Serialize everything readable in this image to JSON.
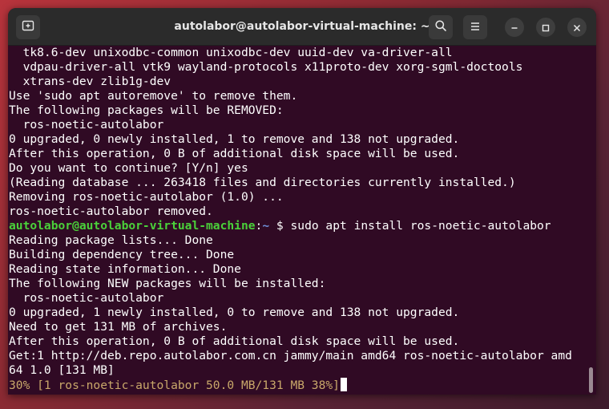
{
  "window": {
    "title": "autolabor@autolabor-virtual-machine: ~"
  },
  "icons": {
    "new_tab": "new-tab-icon",
    "search": "search-icon",
    "menu": "hamburger-menu-icon",
    "minimize": "minimize-icon",
    "maximize": "maximize-icon",
    "close": "close-icon"
  },
  "colors": {
    "terminal_bg": "#300a24",
    "prompt_user": "#4ad13a",
    "prompt_path": "#6f8fd8",
    "progress_text": "#c9a86a"
  },
  "terminal": {
    "lines_before": [
      "  tk8.6-dev unixodbc-common unixodbc-dev uuid-dev va-driver-all",
      "  vdpau-driver-all vtk9 wayland-protocols x11proto-dev xorg-sgml-doctools",
      "  xtrans-dev zlib1g-dev",
      "Use 'sudo apt autoremove' to remove them.",
      "The following packages will be REMOVED:",
      "  ros-noetic-autolabor",
      "0 upgraded, 0 newly installed, 1 to remove and 138 not upgraded.",
      "After this operation, 0 B of additional disk space will be used.",
      "Do you want to continue? [Y/n] yes",
      "(Reading database ... 263418 files and directories currently installed.)",
      "Removing ros-noetic-autolabor (1.0) ...",
      "ros-noetic-autolabor removed."
    ],
    "prompt": {
      "user_host": "autolabor@autolabor-virtual-machine",
      "separator": ":",
      "path": "~",
      "command": "$ sudo apt install ros-noetic-autolabor"
    },
    "lines_after": [
      "Reading package lists... Done",
      "Building dependency tree... Done",
      "Reading state information... Done",
      "The following NEW packages will be installed:",
      "  ros-noetic-autolabor",
      "0 upgraded, 1 newly installed, 0 to remove and 138 not upgraded.",
      "Need to get 131 MB of archives.",
      "After this operation, 0 B of additional disk space will be used.",
      "Get:1 http://deb.repo.autolabor.com.cn jammy/main amd64 ros-noetic-autolabor amd",
      "64 1.0 [131 MB]"
    ],
    "progress_line": "30% [1 ros-noetic-autolabor 50.0 MB/131 MB 38%]"
  }
}
